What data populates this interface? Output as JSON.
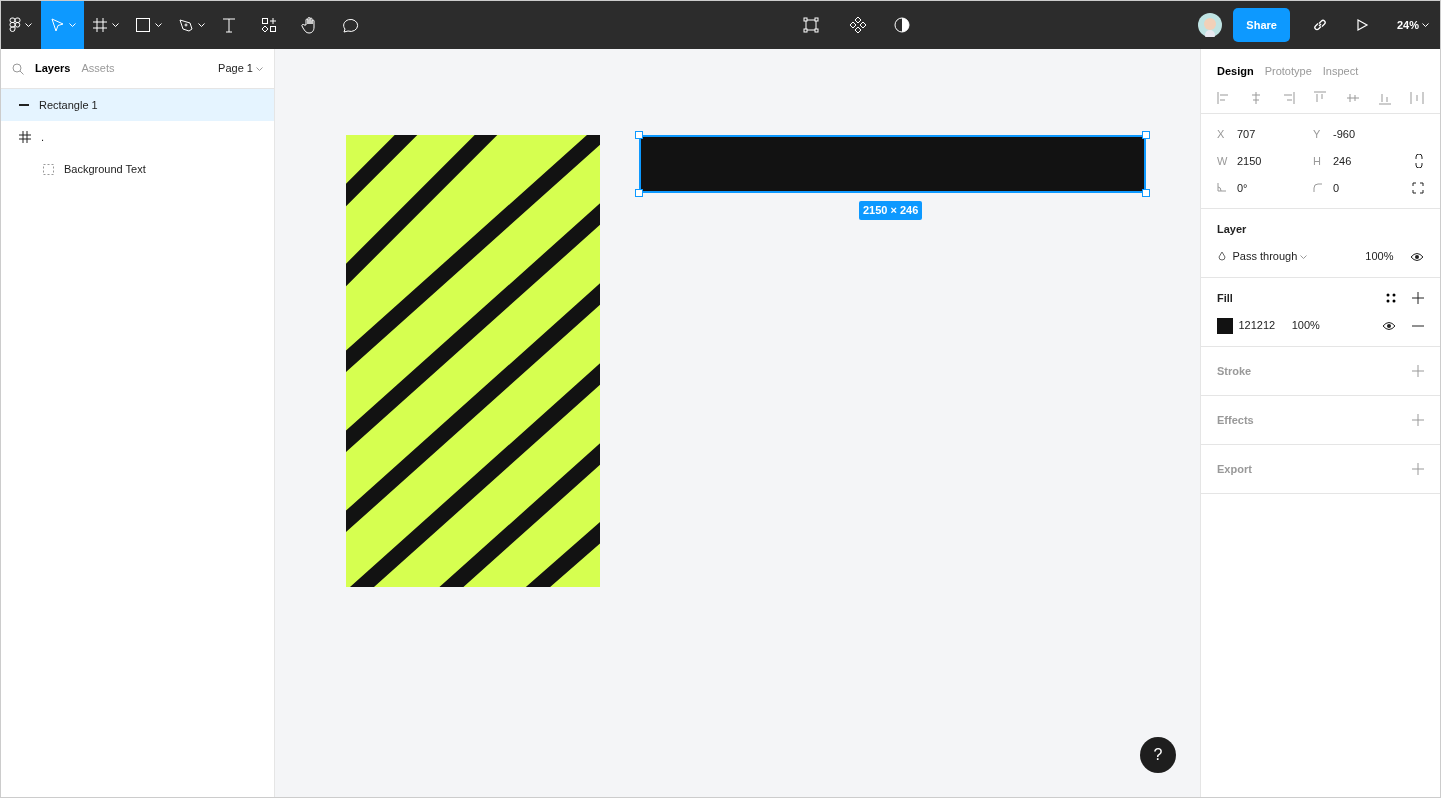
{
  "toolbar": {
    "tools": [
      {
        "kind": "menu",
        "selected": false
      },
      {
        "kind": "move",
        "selected": true
      },
      {
        "kind": "frame",
        "selected": false
      },
      {
        "kind": "shape",
        "selected": false
      },
      {
        "kind": "pen",
        "selected": false
      },
      {
        "kind": "text",
        "selected": false
      },
      {
        "kind": "resources",
        "selected": false
      },
      {
        "kind": "hand",
        "selected": false
      },
      {
        "kind": "comment",
        "selected": false
      }
    ],
    "center_tools": [
      {
        "kind": "edit-object"
      },
      {
        "kind": "component"
      },
      {
        "kind": "contrast"
      }
    ],
    "share": "Share",
    "zoom": "24%"
  },
  "left_panel": {
    "tabs": [
      {
        "label": "Layers",
        "selected": true
      },
      {
        "label": "Assets",
        "selected": false
      }
    ],
    "page": "Page 1",
    "layers": [
      {
        "name": "Rectangle 1",
        "kind": "line",
        "selected": true
      },
      {
        "name": ".",
        "kind": "frame",
        "selected": false,
        "children": [
          {
            "name": "Background Text",
            "kind": "group",
            "selected": false
          }
        ]
      }
    ]
  },
  "canvas": {
    "selection_size": "2150 × 246",
    "help": "?"
  },
  "right_panel": {
    "tabs": [
      {
        "label": "Design",
        "selected": true
      },
      {
        "label": "Prototype",
        "selected": false
      },
      {
        "label": "Inspect",
        "selected": false
      }
    ],
    "geometry": [
      [
        {
          "label": "X",
          "value": "707"
        },
        {
          "label": "Y",
          "value": "-960"
        }
      ],
      [
        {
          "label": "W",
          "value": "2150"
        },
        {
          "label": "H",
          "value": "246"
        }
      ],
      [
        {
          "value": "0°",
          "kind": "rotation"
        },
        {
          "value": "0",
          "kind": "radius"
        }
      ]
    ],
    "layer": {
      "title": "Layer",
      "blend": "Pass through",
      "opacity": "100%"
    },
    "fill": {
      "title": "Fill",
      "color": "#121212",
      "hex": "121212",
      "opacity": "100%"
    },
    "sections": [
      "Stroke",
      "Effects",
      "Export"
    ]
  }
}
